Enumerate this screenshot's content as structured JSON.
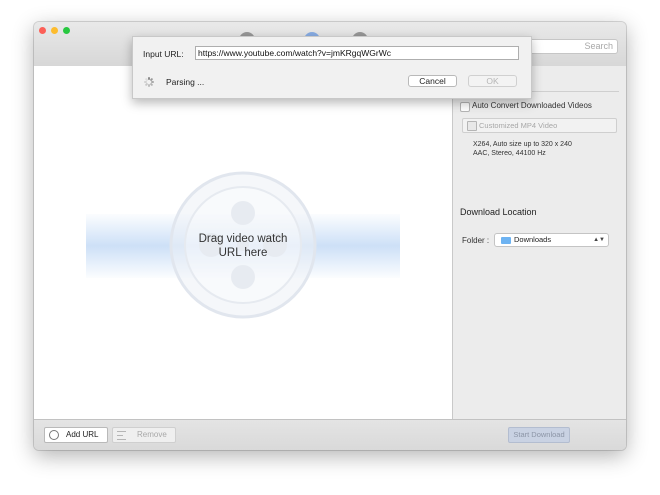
{
  "toolbar": {
    "search_placeholder": "Search"
  },
  "main": {
    "drop_line1": "Drag video watch",
    "drop_line2": "URL here"
  },
  "sidebar": {
    "auto_convert_label": "Auto Convert Downloaded Videos",
    "auto_convert_checked": false,
    "preset_label": "Customized MP4 Video",
    "preset_desc_line1": "X264, Auto size up to 320 x 240",
    "preset_desc_line2": "AAC, Stereo, 44100 Hz",
    "download_location_title": "Download Location",
    "folder_label": "Folder :",
    "folder_value": "Downloads"
  },
  "bottom": {
    "add_url_label": "Add URL",
    "remove_label": "Remove",
    "start_download_label": "Start Download"
  },
  "sheet": {
    "input_label": "Input URL:",
    "url_value": "https://www.youtube.com/watch?v=jmKRgqWGrWc",
    "status_text": "Parsing ...",
    "cancel_label": "Cancel",
    "ok_label": "OK"
  },
  "icons": {
    "add_url": "globe-icon",
    "remove": "list-icon",
    "preset": "video-file-icon",
    "folder": "folder-icon",
    "spinner": "spinner-icon",
    "watermark": "film-reel-icon"
  },
  "colors": {
    "close": "#fc5f57",
    "minimize": "#fdbc2e",
    "maximize": "#28c840",
    "folder": "#6db3f2",
    "drop_band": "#cde0f7"
  }
}
